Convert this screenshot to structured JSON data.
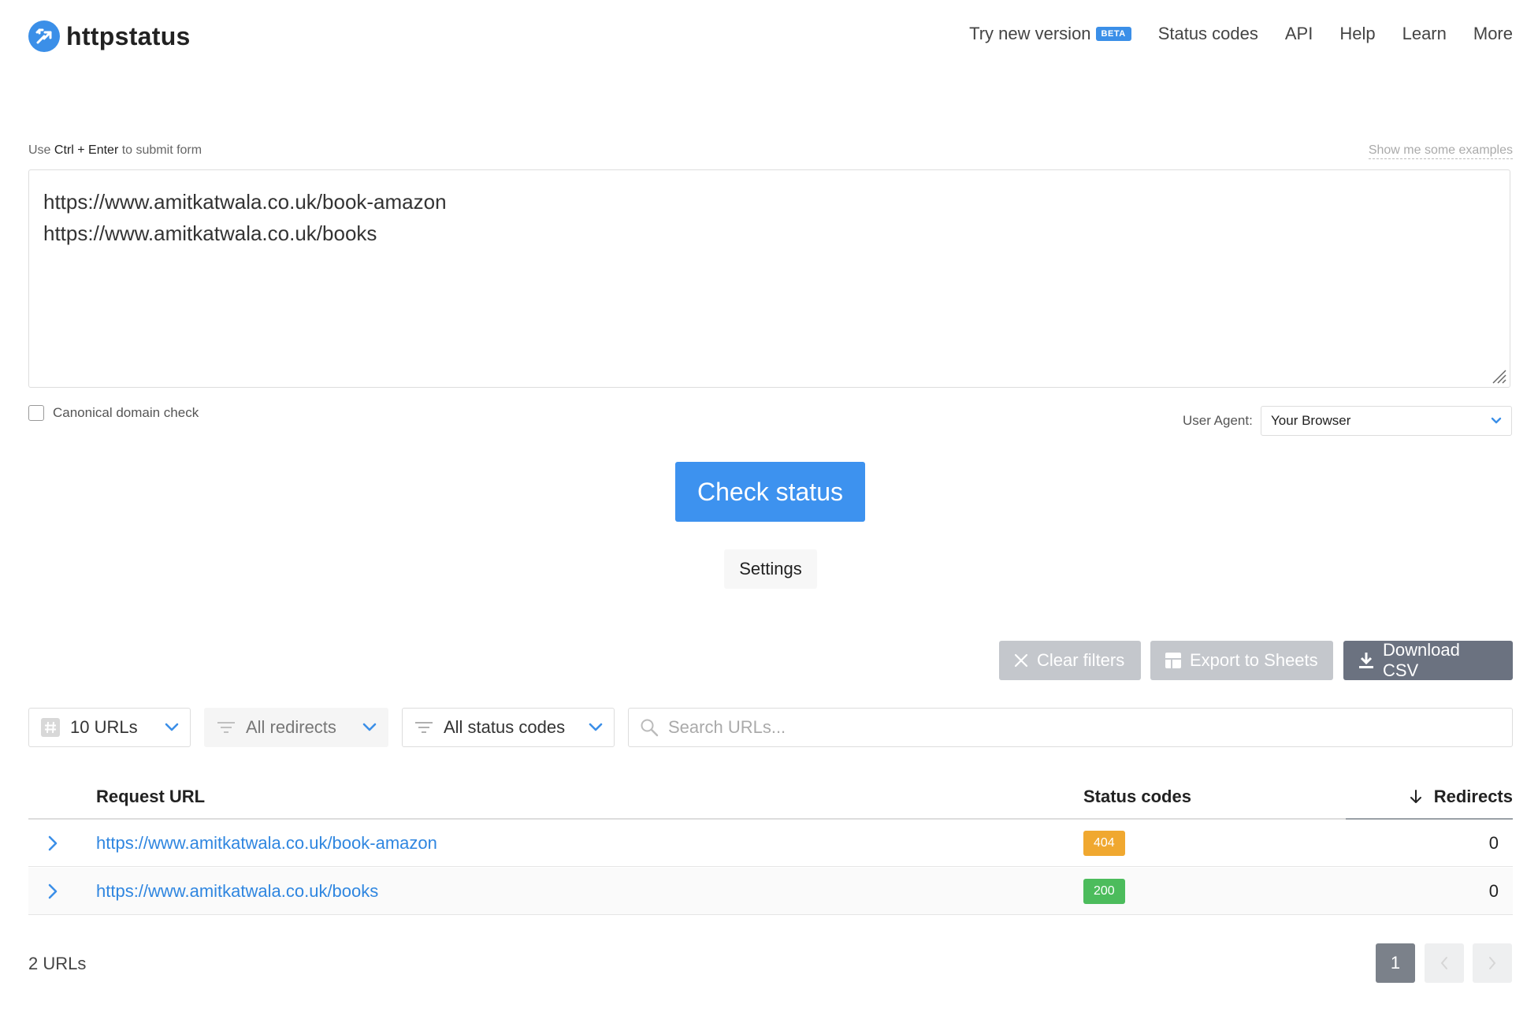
{
  "header": {
    "logo_text": "httpstatus",
    "nav": {
      "try_new": "Try new version",
      "beta": "BETA",
      "status_codes": "Status codes",
      "api": "API",
      "help": "Help",
      "learn": "Learn",
      "more": "More"
    }
  },
  "form": {
    "hint_prefix": "Use",
    "hint_keys": "Ctrl + Enter",
    "hint_suffix": "to submit form",
    "examples_link": "Show me some examples",
    "urls_line1": "https://www.amitkatwala.co.uk/book-amazon",
    "urls_line2": "https://www.amitkatwala.co.uk/books",
    "canonical_label": "Canonical domain check",
    "canonical_checked": false,
    "user_agent_label": "User Agent:",
    "user_agent_value": "Your Browser",
    "check_button": "Check status",
    "settings_button": "Settings"
  },
  "toolbar": {
    "clear_filters": "Clear filters",
    "export_sheets": "Export to Sheets",
    "download_csv": "Download CSV"
  },
  "filters": {
    "urls_per_page": "10 URLs",
    "redirects": "All redirects",
    "status_codes": "All status codes",
    "search_placeholder": "Search URLs..."
  },
  "table": {
    "headers": {
      "request_url": "Request URL",
      "status_codes": "Status codes",
      "redirects": "Redirects"
    },
    "rows": [
      {
        "url": "https://www.amitkatwala.co.uk/book-amazon",
        "status": "404",
        "status_color": "#f0a830",
        "redirects": "0"
      },
      {
        "url": "https://www.amitkatwala.co.uk/books",
        "status": "200",
        "status_color": "#4cbc5c",
        "redirects": "0"
      }
    ]
  },
  "footer": {
    "count": "2 URLs",
    "page": "1"
  },
  "colors": {
    "accent": "#3d92ef",
    "link": "#2f86e0"
  }
}
